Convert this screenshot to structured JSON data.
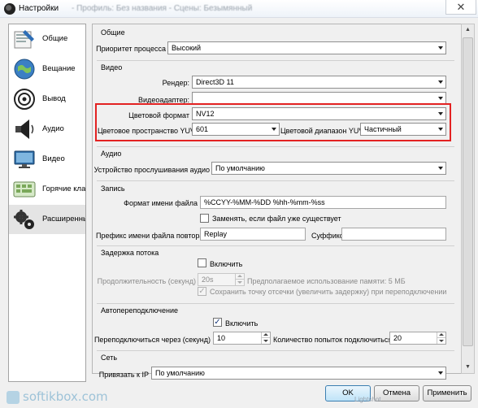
{
  "window": {
    "title": "Настройки",
    "title_rest": "- Профиль: Без названия - Сцены: Безымянный",
    "close_glyph": "✕"
  },
  "sidebar": {
    "items": [
      {
        "label": "Общие",
        "icon": "general-settings-icon",
        "selected": false
      },
      {
        "label": "Вещание",
        "icon": "broadcast-globe-icon",
        "selected": false
      },
      {
        "label": "Вывод",
        "icon": "output-signal-icon",
        "selected": false
      },
      {
        "label": "Аудио",
        "icon": "speaker-icon",
        "selected": false
      },
      {
        "label": "Видео",
        "icon": "monitor-icon",
        "selected": false
      },
      {
        "label": "Горячие клав",
        "icon": "keyboard-icon",
        "selected": false
      },
      {
        "label": "Расширенны",
        "icon": "gears-icon",
        "selected": true
      }
    ]
  },
  "general": {
    "title": "Общие",
    "priority_label": "Приоритет процесса",
    "priority_value": "Высокий"
  },
  "video": {
    "title": "Видео",
    "renderer_label": "Рендер:",
    "renderer_value": "Direct3D 11",
    "adapter_label": "Видеоадаптер:",
    "adapter_value": "",
    "color_format_label": "Цветовой формат",
    "color_format_value": "NV12",
    "color_space_label": "Цветовое пространство YUV",
    "color_space_value": "601",
    "color_range_label": "Цветовой диапазон YUV",
    "color_range_value": "Частичный"
  },
  "audio": {
    "title": "Аудио",
    "monitoring_label": "Устройство прослушивания аудио",
    "monitoring_value": "По умолчанию"
  },
  "recording": {
    "title": "Запись",
    "filename_label": "Формат имени файла",
    "filename_value": "%CCYY-%MM-%DD %hh-%mm-%ss",
    "overwrite_label": "Заменять, если файл уже существует",
    "overwrite_checked": false,
    "replay_prefix_label": "Префикс имени файла повтора",
    "replay_prefix_value": "Replay",
    "suffix_label": "Суффикс",
    "suffix_value": ""
  },
  "stream_delay": {
    "title": "Задержка потока",
    "enable_label": "Включить",
    "enable_checked": false,
    "duration_label": "Продолжительность (секунд)",
    "duration_value": "20s",
    "memory_text": "Предполагаемое использование памяти: 5 МБ",
    "preserve_label": "Сохранить точку отсечки (увеличить задержку) при переподключении",
    "preserve_checked": true
  },
  "reconnect": {
    "title": "Автопереподключение",
    "enable_label": "Включить",
    "enable_checked": true,
    "retry_delay_label": "Переподключиться через (секунд)",
    "retry_delay_value": "10",
    "max_retries_label": "Количество попыток подключиться",
    "max_retries_value": "20"
  },
  "network": {
    "title": "Сеть",
    "bind_ip_label": "Привязать к IP",
    "bind_ip_value": "По умолчанию"
  },
  "buttons": {
    "ok": "OK",
    "cancel": "Отмена",
    "apply": "Применить"
  },
  "watermark": {
    "site": "softikbox.com",
    "lightshot": "Lightshot"
  },
  "colors": {
    "highlight": "#e32222",
    "selected_item": "#e4e4e4",
    "ok_button": "#bfe3f8"
  }
}
